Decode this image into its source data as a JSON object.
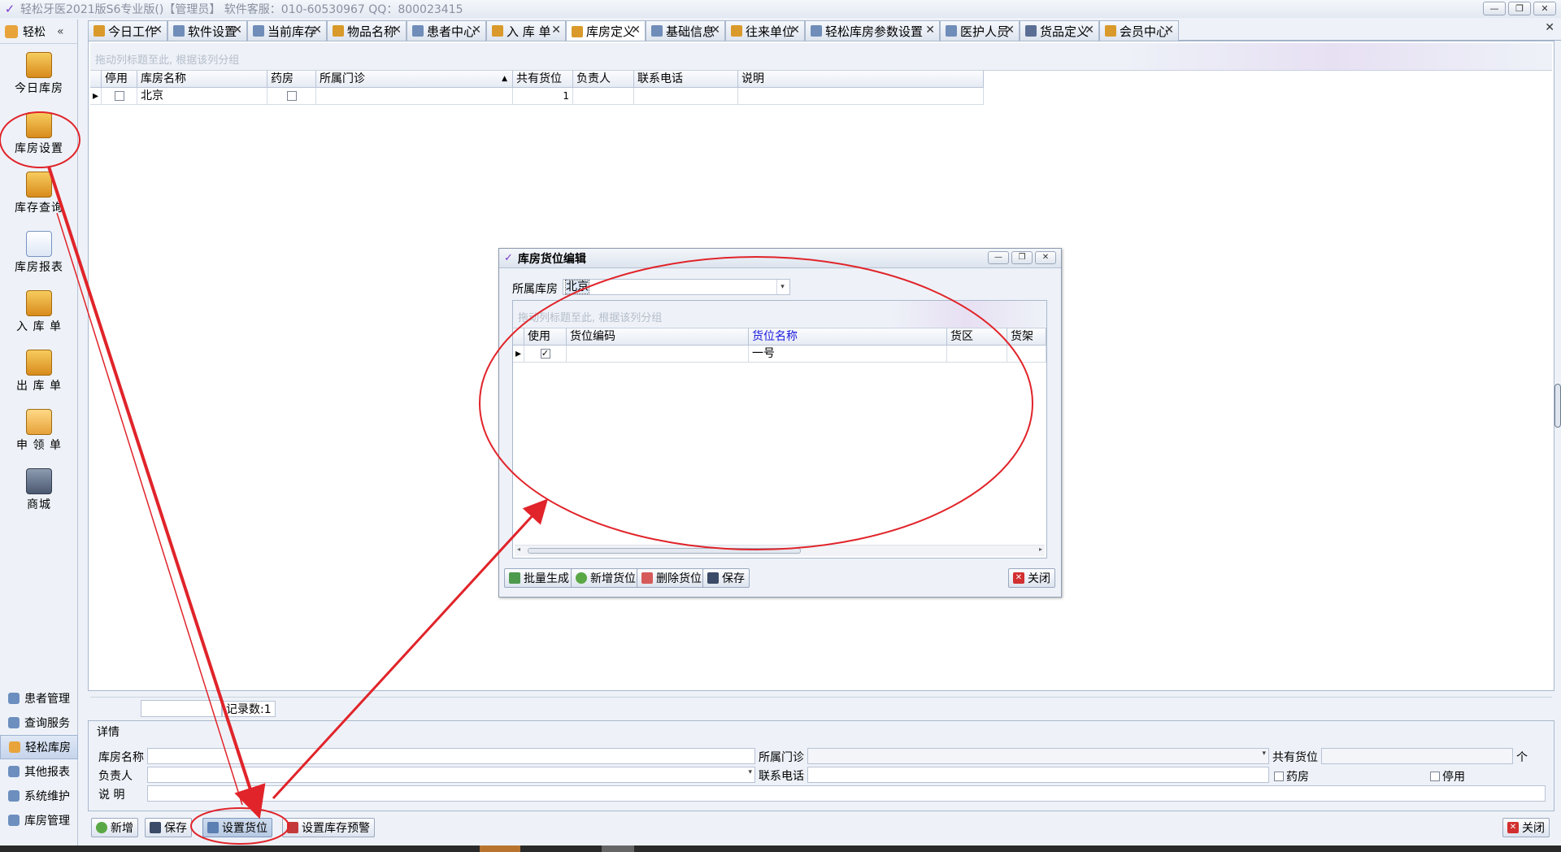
{
  "app": {
    "title": "轻松牙医2021版S6专业版()【管理员】     软件客服：010-60530967  QQ：800023415",
    "window_buttons": [
      "—",
      "❐",
      "✕"
    ]
  },
  "sidebar": {
    "header_label": "轻松",
    "collapse_glyph": "«",
    "items": [
      {
        "label": "今日库房",
        "icon": "warehouse-box-icon"
      },
      {
        "label": "库房设置",
        "icon": "warehouse-settings-icon"
      },
      {
        "label": "库存查询",
        "icon": "boxes-icon"
      },
      {
        "label": "库房报表",
        "icon": "report-chart-icon"
      },
      {
        "label": "入 库 单",
        "icon": "inbound-box-icon"
      },
      {
        "label": "出 库 单",
        "icon": "outbound-box-icon"
      },
      {
        "label": "申 领 单",
        "icon": "hand-icon"
      },
      {
        "label": "商城",
        "icon": "shopping-cart-icon"
      }
    ],
    "bottom_items": [
      {
        "label": "患者管理",
        "icon": "patients-icon"
      },
      {
        "label": "查询服务",
        "icon": "search-icon"
      },
      {
        "label": "轻松库房",
        "icon": "warehouse-icon",
        "active": true
      },
      {
        "label": "其他报表",
        "icon": "report-icon"
      },
      {
        "label": "系统维护",
        "icon": "gear-icon"
      },
      {
        "label": "库房管理",
        "icon": "users-icon"
      }
    ],
    "scroll_glyph": "▾"
  },
  "tabs": [
    {
      "label": "今日工作",
      "icon": "work-icon"
    },
    {
      "label": "软件设置",
      "icon": "settings-icon"
    },
    {
      "label": "当前库存",
      "icon": "table-icon"
    },
    {
      "label": "物品名称",
      "icon": "item-icon"
    },
    {
      "label": "患者中心",
      "icon": "patient-icon"
    },
    {
      "label": "入 库 单",
      "icon": "inbound-icon"
    },
    {
      "label": "库房定义",
      "icon": "warehouse-def-icon",
      "active": true
    },
    {
      "label": "基础信息",
      "icon": "info-icon"
    },
    {
      "label": "往来单位",
      "icon": "partners-icon"
    },
    {
      "label": "轻松库房参数设置",
      "icon": "params-icon"
    },
    {
      "label": "医护人员",
      "icon": "staff-icon"
    },
    {
      "label": "货品定义",
      "icon": "goods-icon"
    },
    {
      "label": "会员中心",
      "icon": "member-icon"
    }
  ],
  "tab_close_glyph": "✕",
  "main_grid": {
    "group_hint": "拖动列标题至此, 根据该列分组",
    "columns": [
      "停用",
      "库房名称",
      "药房",
      "所属门诊",
      "共有货位",
      "负责人",
      "联系电话",
      "说明"
    ],
    "sort_glyph": "▲",
    "row_indicator": "▸",
    "rows": [
      {
        "disabled": false,
        "name": "北京",
        "pharmacy": false,
        "clinic": "",
        "slots": "1",
        "manager": "",
        "phone": "",
        "note": ""
      }
    ],
    "record_count": "记录数:1"
  },
  "details": {
    "title": "详情",
    "labels": {
      "name": "库房名称",
      "clinic": "所属门诊",
      "slots": "共有货位",
      "slots_unit": "个",
      "manager": "负责人",
      "phone": "联系电话",
      "pharmacy": "药房",
      "disabled": "停用",
      "note": "说    明"
    },
    "dropdown_glyph": "▾"
  },
  "toolbar": {
    "new": "新增",
    "save": "保存",
    "set_slots": "设置货位",
    "set_alert": "设置库存预警",
    "close": "关闭"
  },
  "dialog": {
    "title": "库房货位编辑",
    "warehouse_label": "所属库房",
    "warehouse_value": "北京",
    "group_hint": "拖动列标题至此, 根据该列分组",
    "columns": [
      "使用",
      "货位编码",
      "货位名称",
      "货区",
      "货架"
    ],
    "row_indicator": "▸",
    "rows": [
      {
        "used": true,
        "code": "",
        "name": "一号",
        "area": "",
        "shelf": ""
      }
    ],
    "buttons": {
      "batch": "批量生成",
      "add": "新增货位",
      "delete": "删除货位",
      "save": "保存",
      "close": "关闭"
    },
    "window_buttons": [
      "—",
      "❐",
      "✕"
    ],
    "check_glyph": "✓",
    "scroll_left": "◂",
    "scroll_right": "▸"
  },
  "colors": {
    "accent": "#7a3ccc",
    "annotation": "#e0242a",
    "highlight_column": "#1a1adb"
  }
}
